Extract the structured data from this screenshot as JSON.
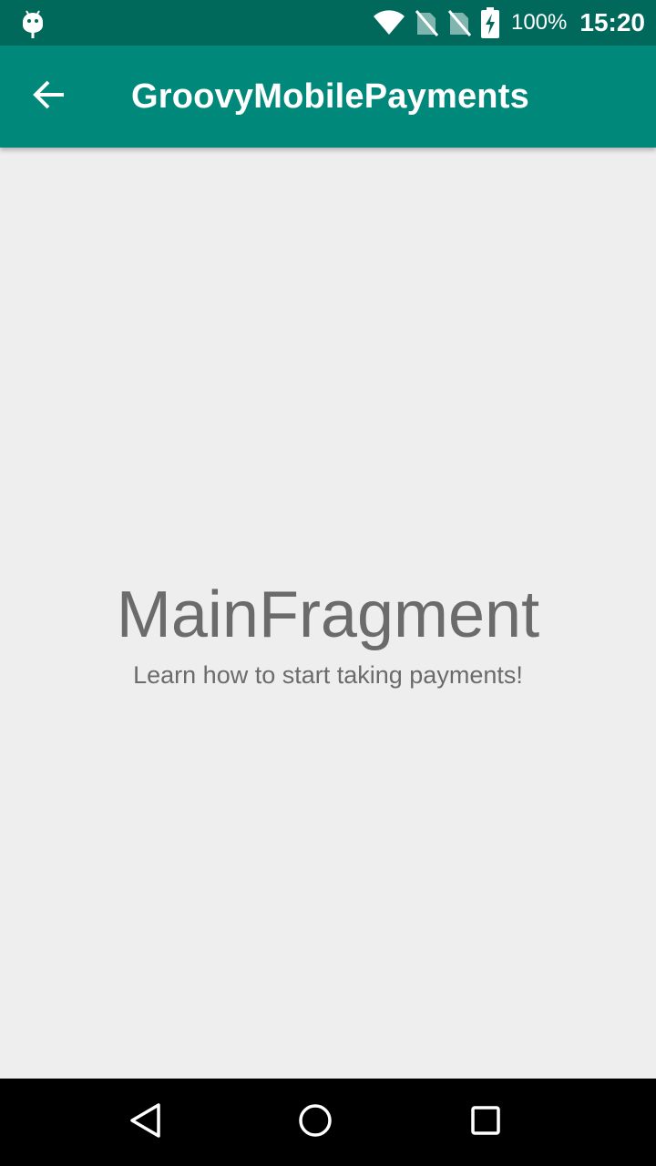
{
  "status_bar": {
    "battery_percent": "100%",
    "time": "15:20",
    "icons": [
      "android-debug-icon",
      "wifi-icon",
      "no-sim-icon",
      "no-sim-icon",
      "battery-charging-icon"
    ]
  },
  "app_bar": {
    "title": "GroovyMobilePayments",
    "back_icon": "arrow-back-icon"
  },
  "content": {
    "title": "MainFragment",
    "subtitle": "Learn how to start taking payments!"
  },
  "nav_bar": {
    "buttons": [
      "nav-back-icon",
      "nav-home-icon",
      "nav-recents-icon"
    ]
  },
  "colors": {
    "status_bar": "#00695c",
    "app_bar": "#00897b",
    "background": "#eeeeee",
    "text_gray": "#6b6b6b"
  }
}
